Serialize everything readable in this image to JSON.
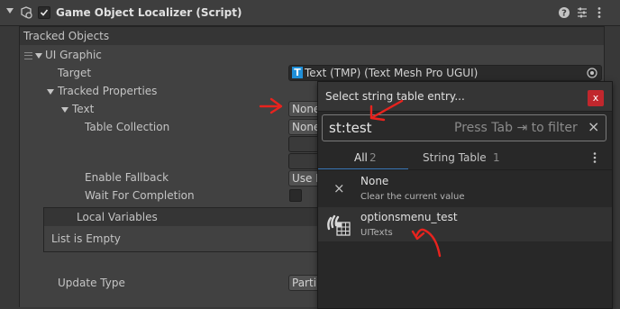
{
  "component": {
    "title": "Game Object Localizer (Script)",
    "help_icon": "question-icon",
    "presets_icon": "sliders-icon",
    "menu_icon": "kebab-icon"
  },
  "tracked_objects": {
    "header": "Tracked Objects",
    "item_label": "UI Graphic",
    "target_label": "Target",
    "target_value": "Text (TMP) (Text Mesh Pro UGUI)",
    "tracked_properties_label": "Tracked Properties",
    "text_label": "Text",
    "text_value": "None",
    "table_collection_label": "Table Collection",
    "table_collection_value": "None",
    "enable_fallback_label": "Enable Fallback",
    "enable_fallback_value": "Use I",
    "wait_for_completion_label": "Wait For Completion",
    "local_variables_label": "Local Variables",
    "list_empty": "List is Empty",
    "update_type_label": "Update Type",
    "update_type_value": "Parti"
  },
  "popup": {
    "title": "Select string table entry...",
    "close_label": "x",
    "search_value": "st:test",
    "search_hint": "Press Tab ⇥ to filter",
    "clear_label": "×",
    "tabs": [
      {
        "label": "All",
        "count": "2"
      },
      {
        "label": "String Table",
        "count": "1"
      }
    ],
    "items": [
      {
        "icon": "clear-x-icon",
        "title": "None",
        "subtitle": "Clear the current value"
      },
      {
        "icon": "string-table-icon",
        "title": "optionsmenu_test",
        "subtitle": "UITexts"
      }
    ]
  },
  "colors": {
    "background": "#383838",
    "accent_blue": "#3a79bb",
    "close_red": "#c1272d",
    "annotation_red": "#e8231e"
  }
}
